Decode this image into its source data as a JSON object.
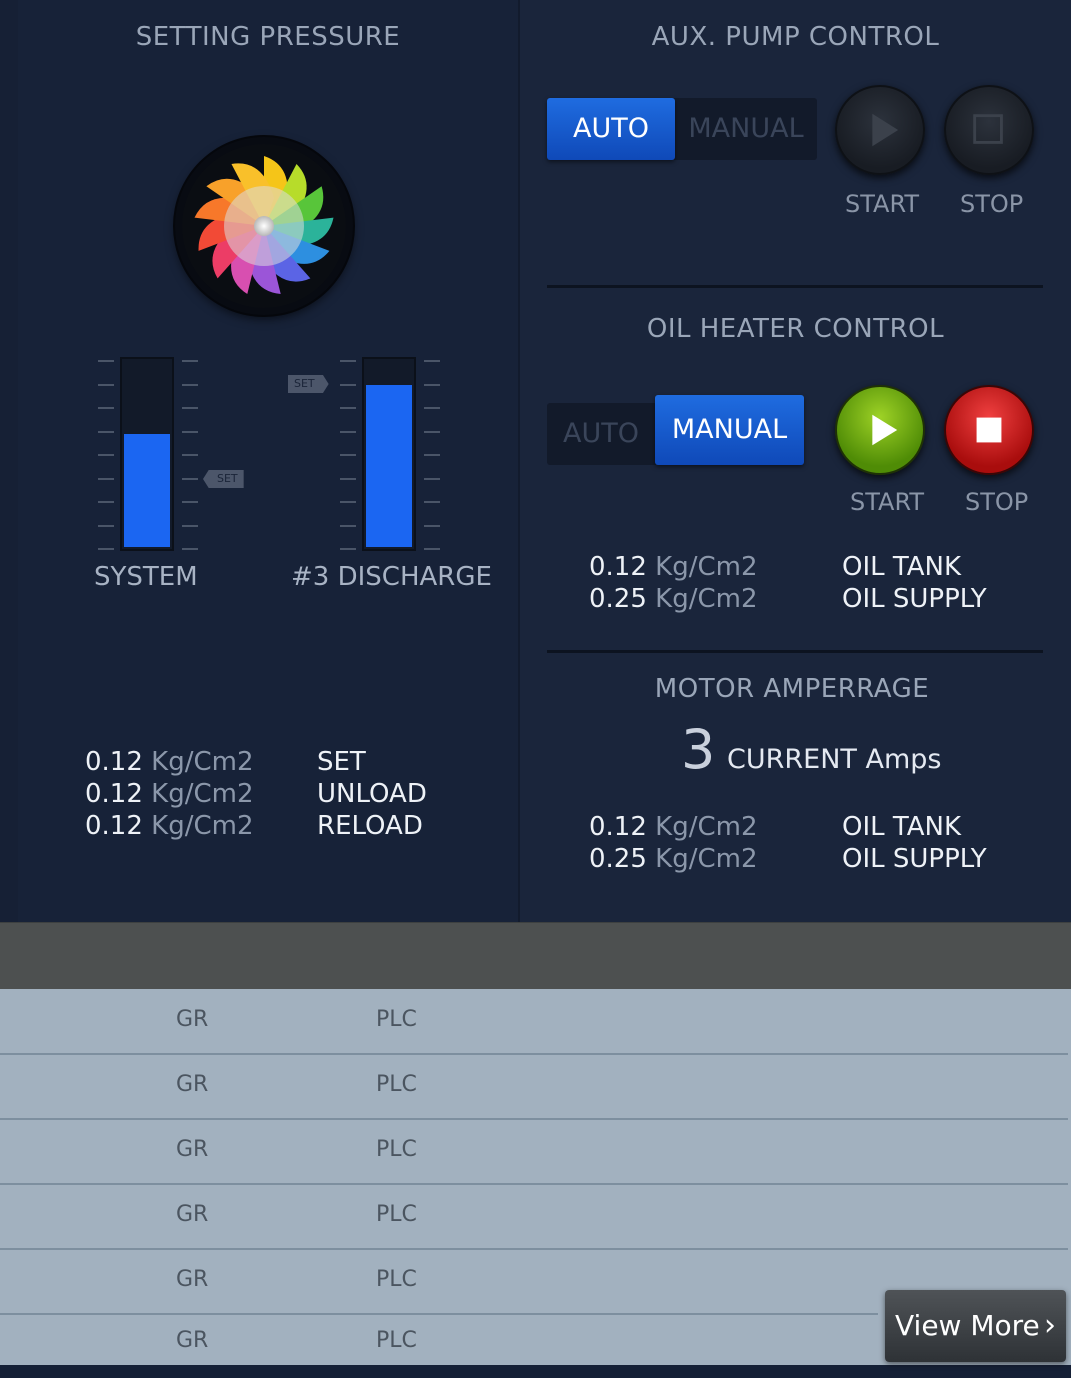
{
  "setting_pressure": {
    "title": "SETTING PRESSURE",
    "bars": [
      {
        "label": "SYSTEM",
        "fill": 0.61,
        "set_tag": "SET"
      },
      {
        "label": "#3 DISCHARGE",
        "fill": 0.87,
        "set_tag": "SET"
      }
    ],
    "readings": [
      {
        "value": "0.12",
        "unit": "Kg/Cm2",
        "label": "SET"
      },
      {
        "value": "0.12",
        "unit": "Kg/Cm2",
        "label": "UNLOAD"
      },
      {
        "value": "0.12",
        "unit": "Kg/Cm2",
        "label": "RELOAD"
      }
    ]
  },
  "aux_pump": {
    "title": "AUX. PUMP CONTROL",
    "mode_auto": "AUTO",
    "mode_manual": "MANUAL",
    "active_mode": "AUTO",
    "start_label": "START",
    "stop_label": "STOP"
  },
  "oil_heater": {
    "title": "OIL HEATER CONTROL",
    "mode_auto": "AUTO",
    "mode_manual": "MANUAL",
    "active_mode": "MANUAL",
    "start_label": "START",
    "stop_label": "STOP",
    "readings": [
      {
        "value": "0.12",
        "unit": "Kg/Cm2",
        "label": "OIL TANK"
      },
      {
        "value": "0.25",
        "unit": "Kg/Cm2",
        "label": "OIL SUPPLY"
      }
    ]
  },
  "motor_amperage": {
    "title": "MOTOR AMPERRAGE",
    "current_value": "3",
    "current_label": "CURRENT Amps",
    "readings": [
      {
        "value": "0.12",
        "unit": "Kg/Cm2",
        "label": "OIL TANK"
      },
      {
        "value": "0.25",
        "unit": "Kg/Cm2",
        "label": "OIL SUPPLY"
      }
    ]
  },
  "table": {
    "rows": [
      {
        "col1": "GR",
        "col2": "PLC"
      },
      {
        "col1": "GR",
        "col2": "PLC"
      },
      {
        "col1": "GR",
        "col2": "PLC"
      },
      {
        "col1": "GR",
        "col2": "PLC"
      },
      {
        "col1": "GR",
        "col2": "PLC"
      },
      {
        "col1": "GR",
        "col2": "PLC"
      }
    ],
    "view_more": "View More"
  },
  "colors": {
    "accent_blue": "#1b66f2",
    "start_green": "#6fae12",
    "stop_red": "#d11d1d"
  }
}
